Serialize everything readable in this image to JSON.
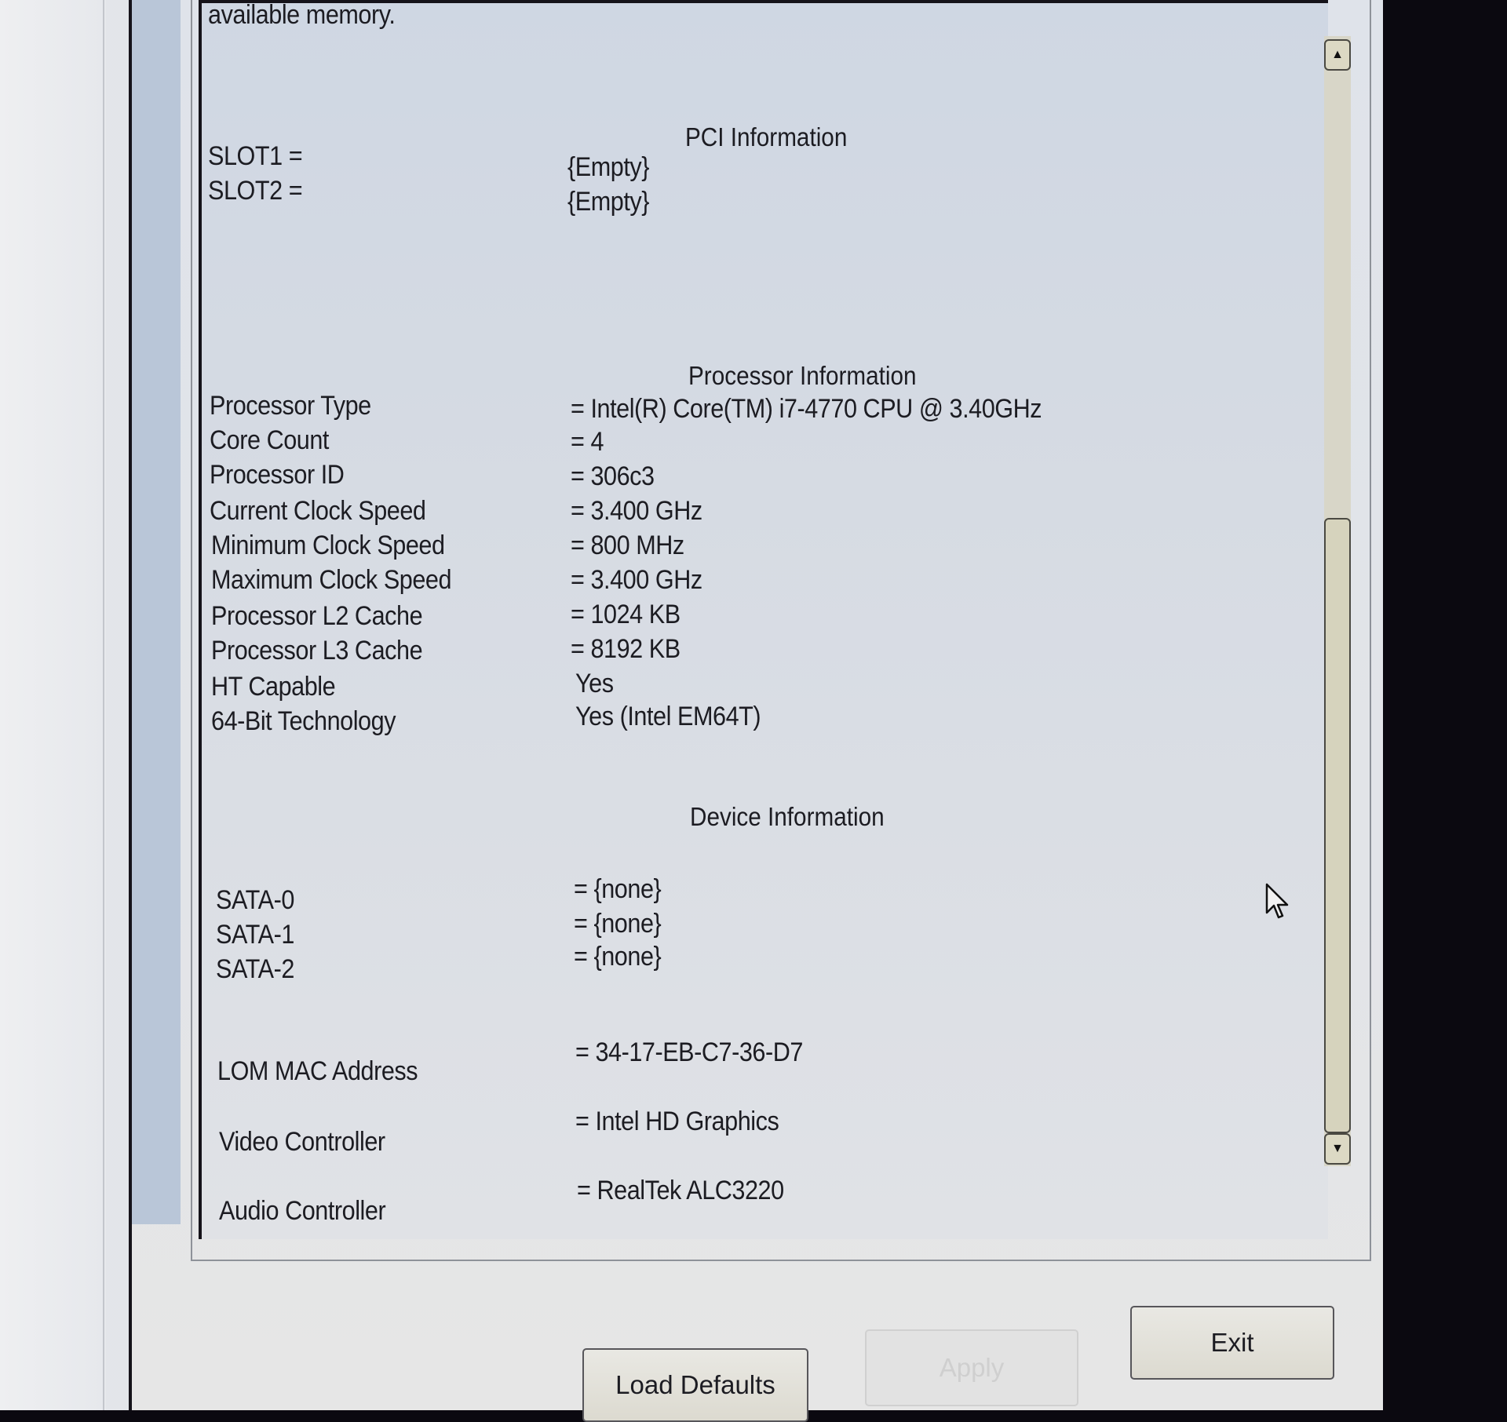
{
  "top_text": "available memory.",
  "pci": {
    "heading": "PCI Information",
    "rows": [
      {
        "label": "SLOT1 =",
        "value": "{Empty}"
      },
      {
        "label": "SLOT2 =",
        "value": "{Empty}"
      }
    ]
  },
  "processor": {
    "heading": "Processor Information",
    "rows": [
      {
        "label": "Processor Type",
        "value": "= Intel(R) Core(TM) i7-4770 CPU @ 3.40GHz"
      },
      {
        "label": "Core Count",
        "value": "= 4"
      },
      {
        "label": "Processor ID",
        "value": "= 306c3"
      },
      {
        "label": "Current Clock Speed",
        "value": "= 3.400 GHz"
      },
      {
        "label": "Minimum Clock Speed",
        "value": "= 800 MHz"
      },
      {
        "label": "Maximum Clock Speed",
        "value": "= 3.400 GHz"
      },
      {
        "label": "Processor L2 Cache",
        "value": "= 1024 KB"
      },
      {
        "label": "Processor L3 Cache",
        "value": "= 8192 KB"
      },
      {
        "label": "HT Capable",
        "value": "Yes"
      },
      {
        "label": "64-Bit Technology",
        "value": "Yes (Intel EM64T)"
      }
    ]
  },
  "device": {
    "heading": "Device Information",
    "rows": [
      {
        "label": "SATA-0",
        "value": "= {none}"
      },
      {
        "label": "SATA-1",
        "value": "= {none}"
      },
      {
        "label": "SATA-2",
        "value": "= {none}"
      },
      {
        "label": "LOM MAC Address",
        "value": "= 34-17-EB-C7-36-D7"
      },
      {
        "label": "Video Controller",
        "value": "= Intel HD Graphics"
      },
      {
        "label": "Audio Controller",
        "value": "= RealTek ALC3220"
      }
    ]
  },
  "scrollbar": {
    "up_icon": "▲",
    "down_icon": "▼"
  },
  "buttons": {
    "load_defaults": "Load Defaults",
    "apply": "Apply",
    "exit": "Exit"
  }
}
